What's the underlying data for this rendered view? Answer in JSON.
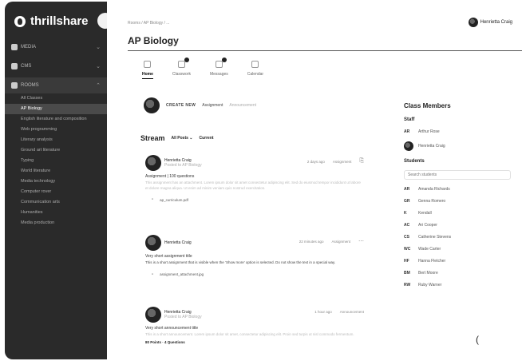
{
  "app": {
    "name": "thrillshare"
  },
  "sidebar": {
    "nav": [
      {
        "label": "MEDIA",
        "active": false
      },
      {
        "label": "CMS",
        "active": false
      },
      {
        "label": "ROOMS",
        "active": true
      }
    ],
    "rooms": [
      "All Classes",
      "AP Biology",
      "English literature and composition",
      "Web programming",
      "Literary analysis",
      "Ground art literature",
      "Typing",
      "World literature",
      "Media technology",
      "Computer rover",
      "Communication arts",
      "Humanities",
      "Media production"
    ]
  },
  "header": {
    "breadcrumb": "Rooms / AP Biology / ...",
    "user_name": "Henrietta Craig",
    "title": "AP Biology"
  },
  "tabs": [
    {
      "label": "Home",
      "active": true,
      "badge": false
    },
    {
      "label": "Classwork",
      "active": false,
      "badge": true
    },
    {
      "label": "Messages",
      "active": false,
      "badge": true
    },
    {
      "label": "Calendar",
      "active": false,
      "badge": false
    }
  ],
  "create_row": {
    "create_label": "CREATE NEW",
    "assignment_label": "Assignment",
    "announcement_label": "Announcement"
  },
  "stream": {
    "title": "Stream",
    "filter_label": "All Posts ⌄",
    "current_label": "Current"
  },
  "posts": [
    {
      "author": "Henrietta Craig",
      "sub": "Posted to AP Biology",
      "meta": "2 days ago",
      "type": "Assignment",
      "title": "Assignment | 100 questions",
      "body": "This assignment has an attachment. Lorem ipsum dolor sit amet consectetur adipiscing elit. Sed do eiusmod tempor incididunt ut labore et dolore magna aliqua. Ut enim ad minim veniam quis nostrud exercitation.",
      "attachment": "ap_curriculum.pdf",
      "foot": ""
    },
    {
      "author": "Henrietta Craig",
      "sub": "",
      "meta": "22 minutes ago",
      "type": "Assignment",
      "title": "Very short assignment title",
      "body": "This is a short assignment that is visible when the ‘Show more’ option is selected. Do not show the text in a special way.",
      "attachment": "assignment_attachment.jpg",
      "foot": ""
    },
    {
      "author": "Henrietta Craig",
      "sub": "Posted to AP Biology",
      "meta": "1 hour ago",
      "type": "Announcement",
      "title": "Very short announcement title",
      "body": "This is a short announcement. Lorem ipsum dolor sit amet, consectetur adipiscing elit. Proin sed turpis ut nisl commodo fermentum.",
      "attachment": "",
      "foot": "80 Points · 4 Questions"
    }
  ],
  "members": {
    "title": "Class Members",
    "staff_label": "Staff",
    "staff": [
      {
        "initials": "AR",
        "name": "Arthur Rose"
      },
      {
        "initials": "",
        "name": "Henrietta Craig"
      }
    ],
    "students_label": "Students",
    "search_placeholder": "Search students",
    "students": [
      {
        "initials": "AR",
        "name": "Amanda Richards"
      },
      {
        "initials": "GR",
        "name": "Genna Romero"
      },
      {
        "initials": "K",
        "name": "Kendall"
      },
      {
        "initials": "AC",
        "name": "Ari Cooper"
      },
      {
        "initials": "CS",
        "name": "Catherine Stevens"
      },
      {
        "initials": "WC",
        "name": "Wade Carter"
      },
      {
        "initials": "HF",
        "name": "Hanna Fletcher"
      },
      {
        "initials": "BM",
        "name": "Bert Moore"
      },
      {
        "initials": "RW",
        "name": "Ruby Warner"
      }
    ]
  },
  "colors": {
    "sidebar_bg": "#2a2a2a",
    "accent": "#222222"
  }
}
